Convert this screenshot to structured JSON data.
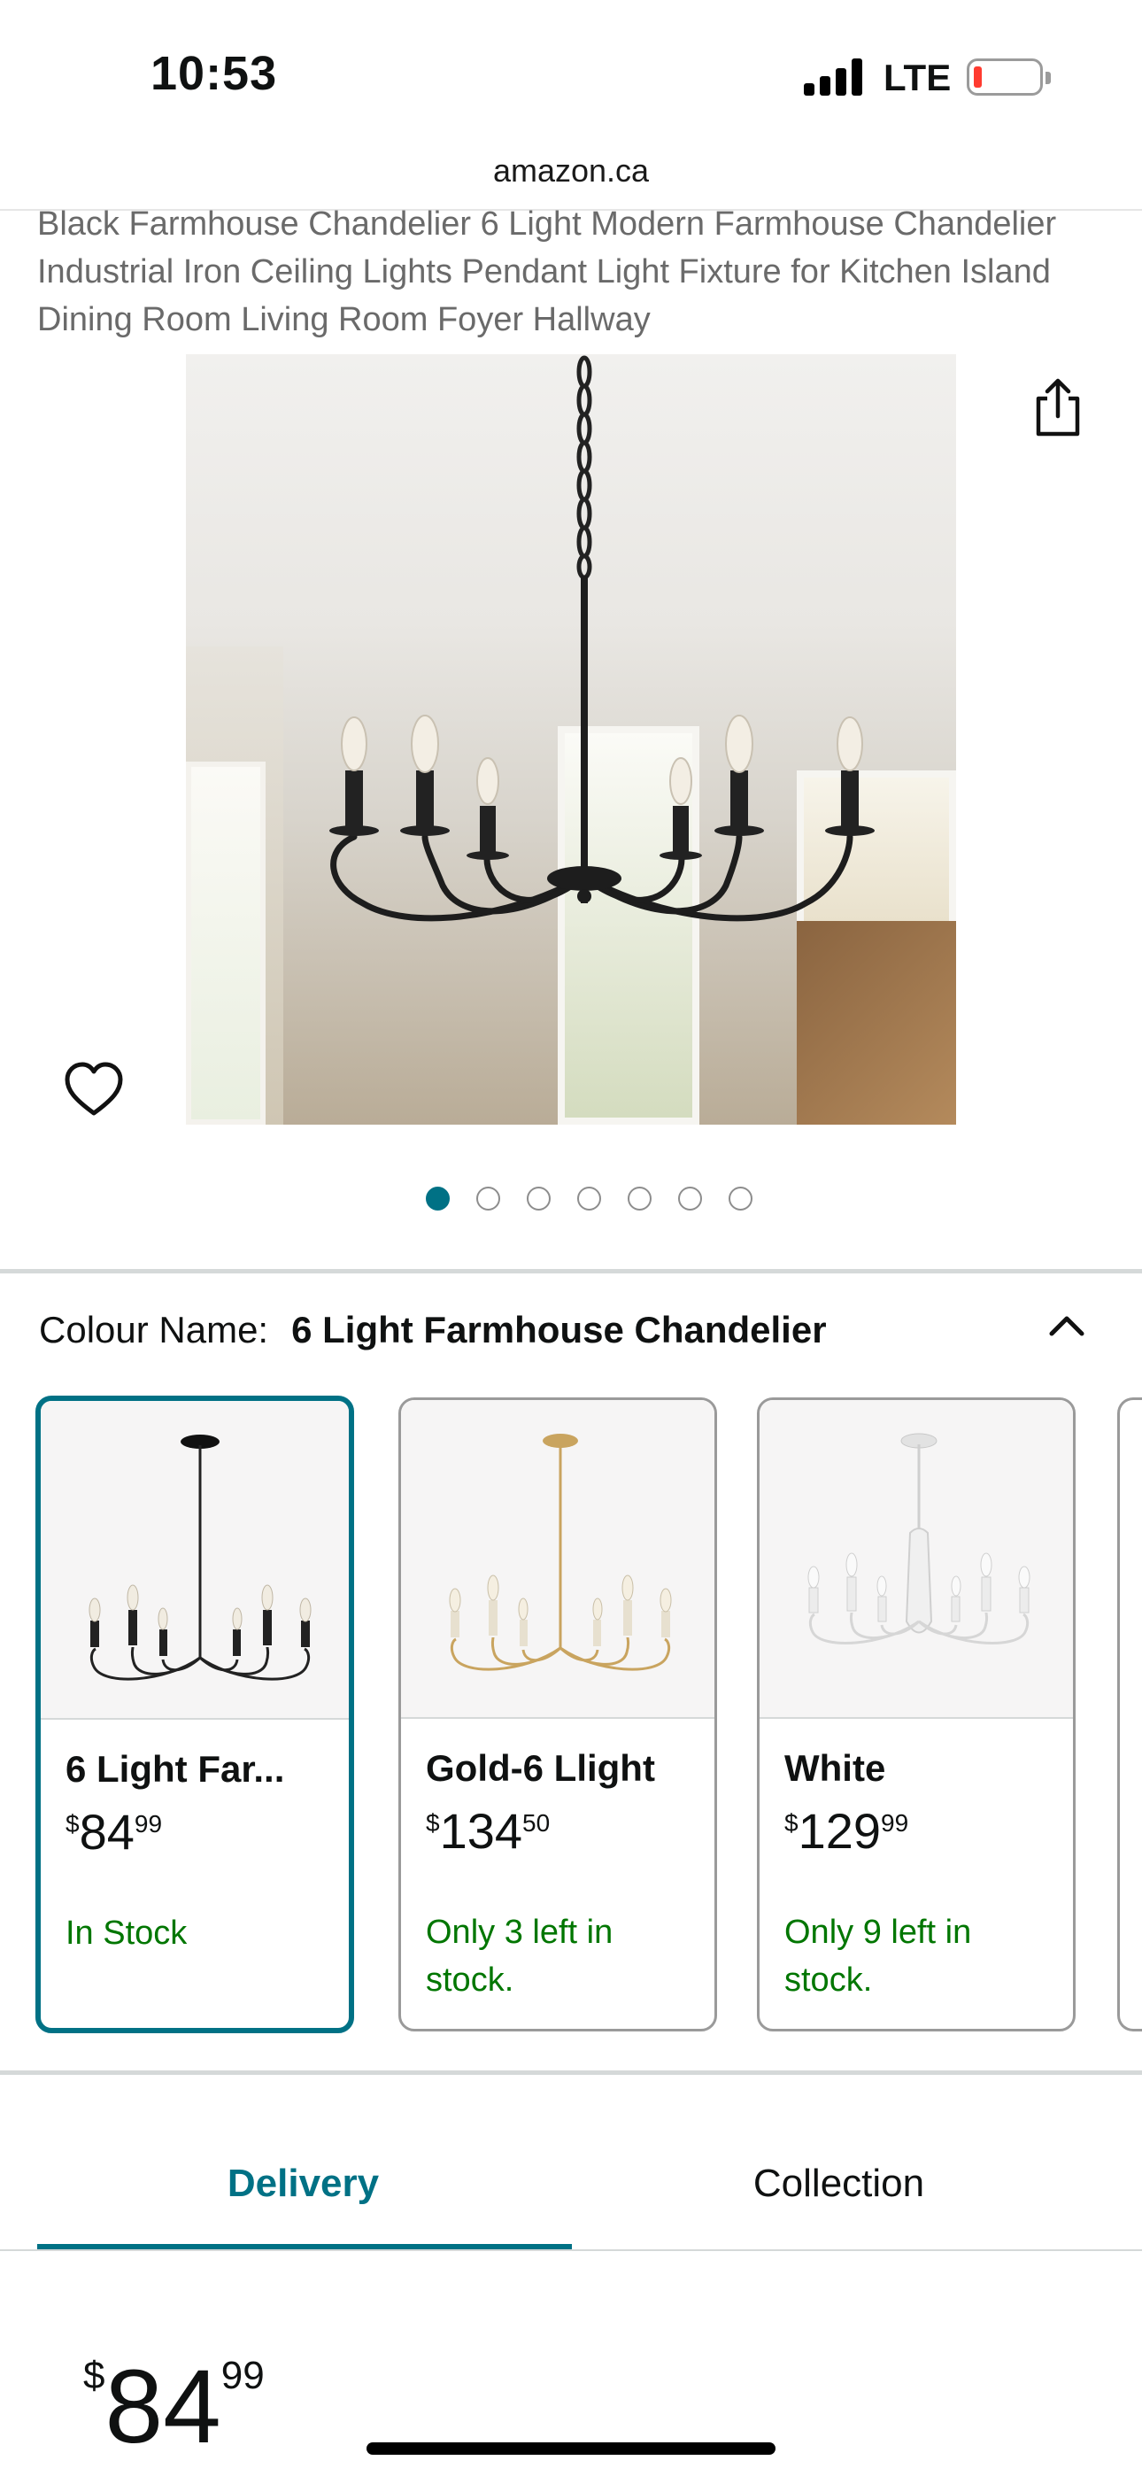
{
  "status_bar": {
    "time": "10:53",
    "network": "LTE"
  },
  "browser": {
    "url": "amazon.ca"
  },
  "product": {
    "title": "Black Farmhouse Chandelier 6 Light Modern Farmhouse Chandelier Industrial Iron Ceiling Lights Pendant Light Fixture for Kitchen Island Dining Room Living Room Foyer Hallway",
    "image_count": 7,
    "active_image": 1
  },
  "colour": {
    "label": "Colour Name:",
    "value": "6 Light Farmhouse Chandelier"
  },
  "variants": [
    {
      "name": "6 Light Far...",
      "currency": "$",
      "whole": "84",
      "fraction": "99",
      "stock": "In Stock",
      "selected": true,
      "finish": "black"
    },
    {
      "name": "Gold-6 Llight",
      "currency": "$",
      "whole": "134",
      "fraction": "50",
      "stock": "Only 3 left in stock.",
      "selected": false,
      "finish": "gold"
    },
    {
      "name": "White",
      "currency": "$",
      "whole": "129",
      "fraction": "99",
      "stock": "Only 9 left in stock.",
      "selected": false,
      "finish": "white"
    }
  ],
  "tabs": {
    "delivery": "Delivery",
    "collection": "Collection"
  },
  "price": {
    "currency": "$",
    "whole": "84",
    "fraction": "99"
  },
  "colors": {
    "accent": "#007185",
    "in_stock": "#007600"
  },
  "icons": {
    "share": "share-icon",
    "wishlist": "heart-icon",
    "collapse": "chevron-up-icon"
  }
}
